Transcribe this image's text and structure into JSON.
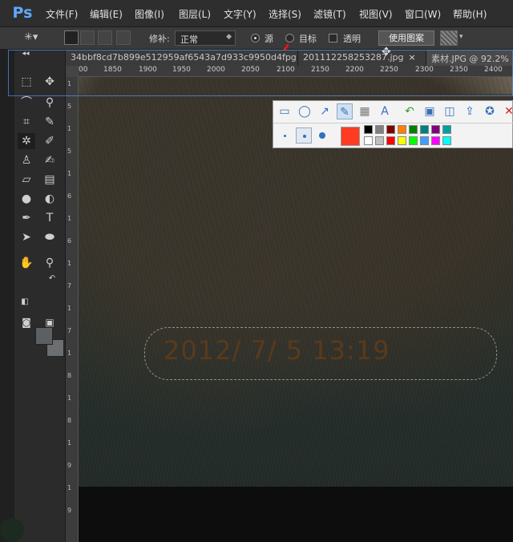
{
  "app": {
    "logo": "Ps"
  },
  "menus": [
    "文件(F)",
    "编辑(E)",
    "图像(I)",
    "图层(L)",
    "文字(Y)",
    "选择(S)",
    "滤镜(T)",
    "视图(V)",
    "窗口(W)",
    "帮助(H)"
  ],
  "options": {
    "repair_label": "修补:",
    "mode_value": "正常",
    "source_label": "源",
    "target_label": "目标",
    "transparent_label": "透明",
    "use_pattern_label": "使用图案"
  },
  "tabs": [
    {
      "label": "34bbf8cd7b899e512959af6543a7d933c9950d4fpg"
    },
    {
      "label": "201112258253287.jpg"
    },
    {
      "label": "素材.JPG @ 92.2%"
    }
  ],
  "ruler": {
    "h_ticks": [
      "00",
      "1850",
      "1900",
      "1950",
      "2000",
      "2050",
      "2100",
      "2150",
      "2200",
      "2250",
      "2300",
      "2350",
      "2400"
    ],
    "v_ticks": [
      "1",
      "5",
      "1",
      "5",
      "1",
      "6",
      "1",
      "6",
      "1",
      "7",
      "1",
      "7",
      "1",
      "8",
      "1",
      "8",
      "1",
      "9",
      "1",
      "9"
    ]
  },
  "photo": {
    "timestamp": "2012/ 7/ 5 13:19"
  },
  "colors": {
    "accent": "#ff3b21",
    "palette": [
      "#000000",
      "#808080",
      "#800000",
      "#ff8000",
      "#008000",
      "#008080",
      "#800080",
      "#00a0a0",
      "#ffffff",
      "#c0c0c0",
      "#ff0000",
      "#ffff00",
      "#00ff00",
      "#40a0ff",
      "#ff00ff",
      "#00ffff"
    ]
  },
  "icons": {
    "snap_tools": [
      "rectangle-icon",
      "ellipse-icon",
      "arrow-icon",
      "pen-icon",
      "mosaic-icon",
      "text-icon",
      "undo-icon",
      "save-icon",
      "copy-icon",
      "share-icon",
      "pin-icon"
    ]
  }
}
